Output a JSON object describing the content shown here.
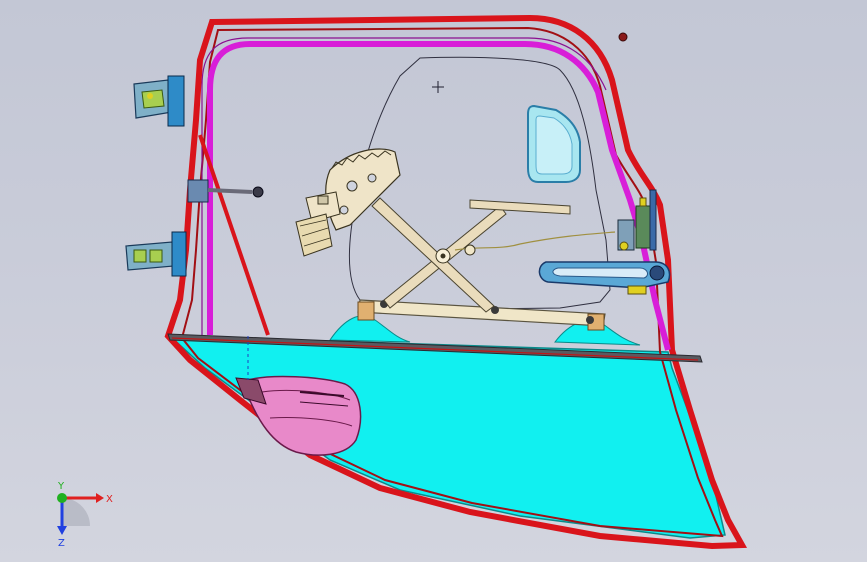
{
  "viewport": {
    "background_top": "#c3c7d5",
    "background_bottom": "#d3d5df"
  },
  "model": {
    "parts": [
      "door-frame",
      "window-run-channel",
      "door-glass",
      "window-regulator",
      "window-motor",
      "upper-hinge",
      "lower-hinge",
      "door-check",
      "inner-handle",
      "door-latch",
      "speaker-housing",
      "inner-belt-strip",
      "access-opening"
    ],
    "colors": {
      "frame": "#d9141b",
      "run_channel": "#d81ed8",
      "glass": "#11f0f0",
      "regulator": "#e8dcc0",
      "handle": "#5aa8d6",
      "speaker": "#e889c9",
      "hinge": "#2e8bc8",
      "accent_yellow": "#e0d020"
    }
  },
  "triad": {
    "x_label": "X",
    "y_label": "Y",
    "z_label": "Z",
    "x_color": "#e02020",
    "y_color": "#20b020",
    "z_color": "#2040e0"
  }
}
